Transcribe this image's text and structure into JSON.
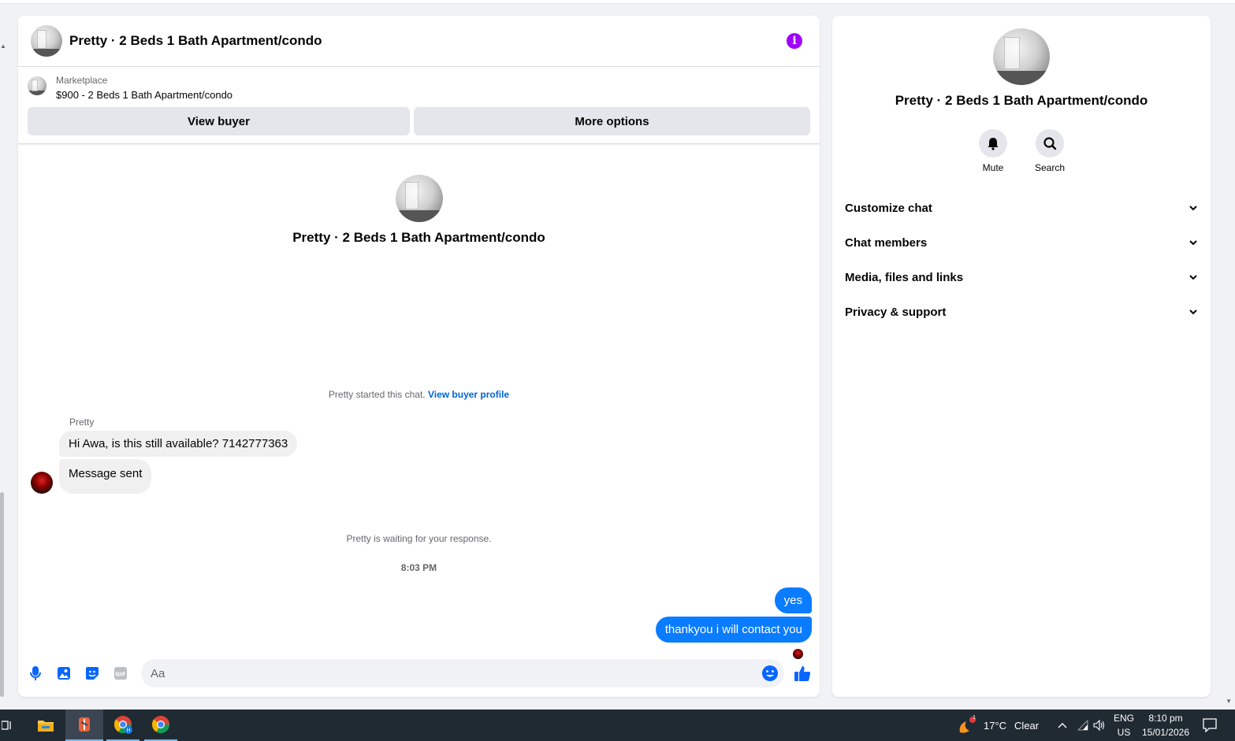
{
  "chat": {
    "header_title": "Pretty · 2 Beds 1 Bath Apartment/condo",
    "marketplace_label": "Marketplace",
    "listing_text": "$900 - 2 Beds 1 Bath Apartment/condo",
    "view_buyer_label": "View buyer",
    "more_options_label": "More options",
    "intro_title": "Pretty · 2 Beds 1 Bath Apartment/condo",
    "started_text": "Pretty started this chat.",
    "view_buyer_profile_label": "View buyer profile",
    "sender_name": "Pretty",
    "messages": [
      {
        "direction": "in",
        "text": "Hi Awa, is this still available? 7142777363"
      },
      {
        "direction": "in",
        "text": "Message sent"
      },
      {
        "direction": "out",
        "text": "yes"
      },
      {
        "direction": "out",
        "text": "thankyou i will contact you"
      }
    ],
    "waiting_text": "Pretty is waiting for your response.",
    "timestamp": "8:03 PM",
    "composer_placeholder": "Aa"
  },
  "info_panel": {
    "name": "Pretty · 2 Beds 1 Bath Apartment/condo",
    "mute_label": "Mute",
    "search_label": "Search",
    "sections": [
      "Customize chat",
      "Chat members",
      "Media, files and links",
      "Privacy & support"
    ]
  },
  "taskbar": {
    "weather_temp": "17°C",
    "weather_desc": "Clear",
    "lang_top": "ENG",
    "lang_bottom": "US",
    "time": "8:10 pm",
    "date": "15/01/2026",
    "weather_badge": "1"
  },
  "colors": {
    "accent_blue": "#0a7cff",
    "info_purple": "#a100ff",
    "link_blue": "#0064d1"
  }
}
